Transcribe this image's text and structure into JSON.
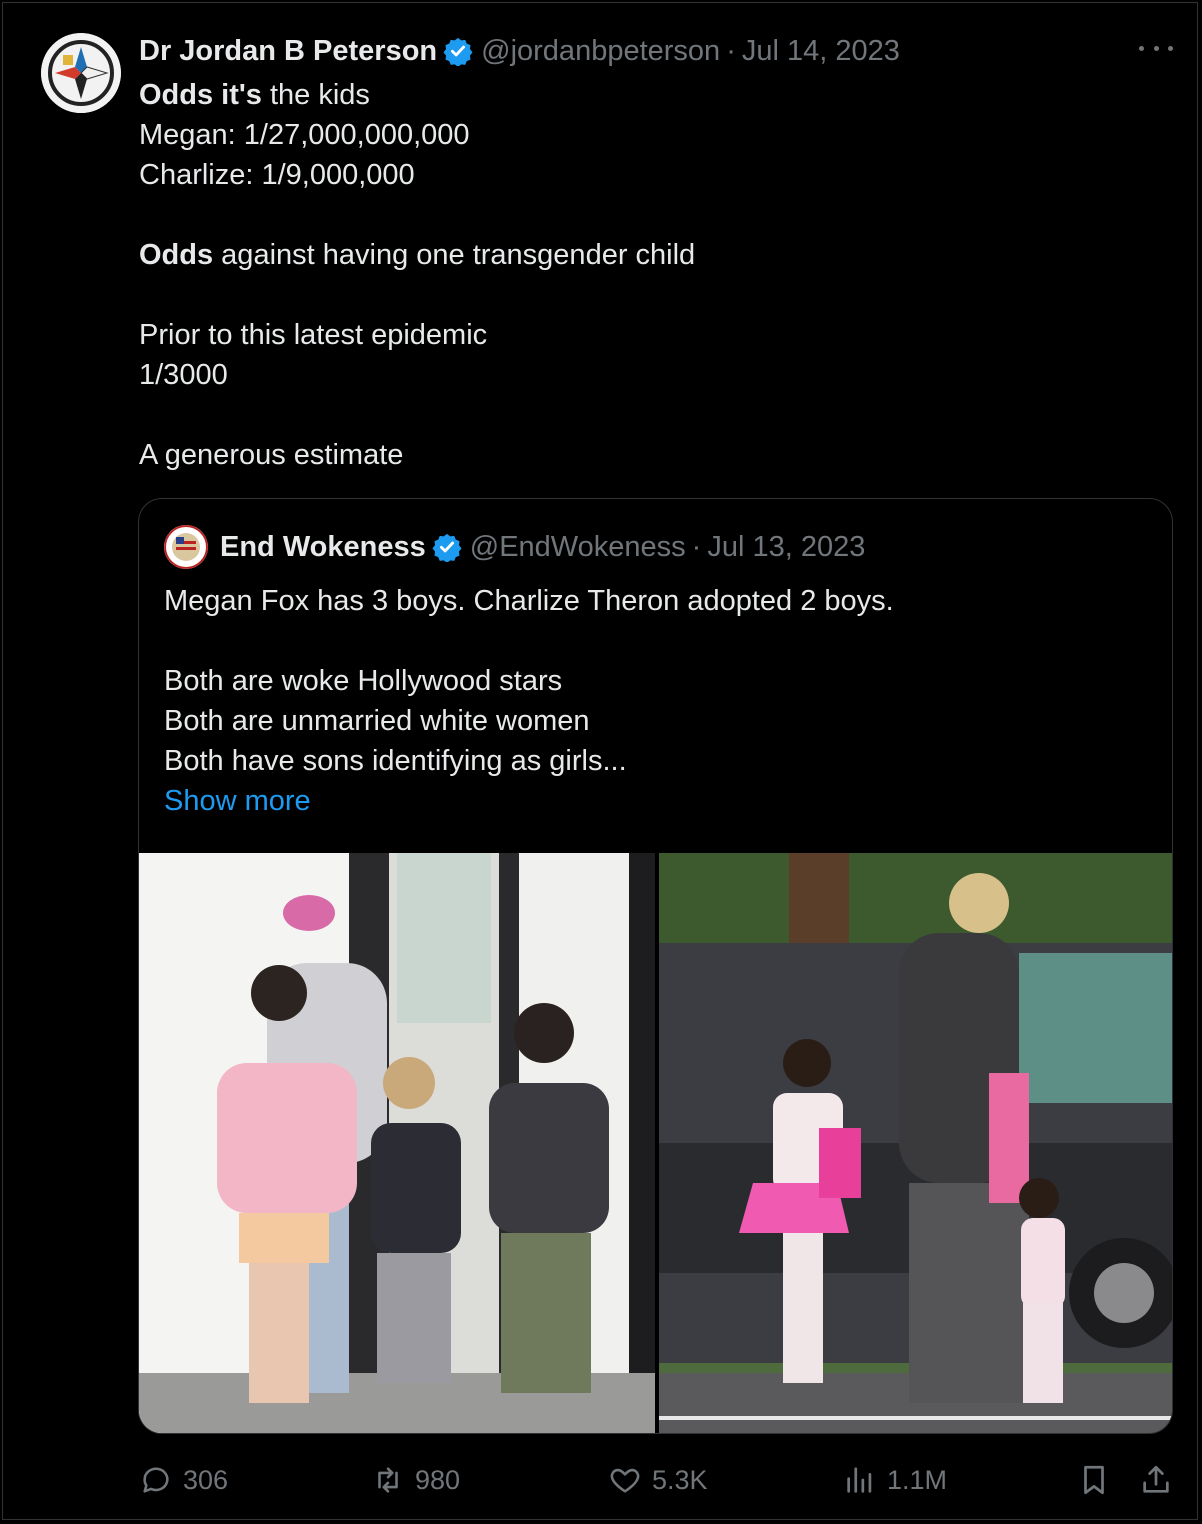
{
  "tweet": {
    "author_name": "Dr Jordan B Peterson",
    "handle": "@jordanbpeterson",
    "separator": "·",
    "date": "Jul 14, 2023",
    "lines": [
      {
        "bold": "Odds it's",
        "rest": " the kids"
      },
      {
        "bold": "",
        "rest": "Megan: 1/27,000,000,000"
      },
      {
        "bold": "",
        "rest": "Charlize: 1/9,000,000"
      },
      {
        "bold": "",
        "rest": ""
      },
      {
        "bold": "Odds",
        "rest": " against having one transgender child"
      },
      {
        "bold": "",
        "rest": ""
      },
      {
        "bold": "",
        "rest": "Prior to this latest epidemic"
      },
      {
        "bold": "",
        "rest": "1/3000"
      },
      {
        "bold": "",
        "rest": ""
      },
      {
        "bold": "",
        "rest": "A generous estimate"
      }
    ]
  },
  "quoted": {
    "author_name": "End Wokeness",
    "handle": "@EndWokeness",
    "separator": "·",
    "date": "Jul 13, 2023",
    "lines": [
      "Megan Fox has 3 boys. Charlize Theron adopted 2 boys.",
      "",
      "Both are woke Hollywood stars",
      "Both are unmarried white women",
      "Both have sons identifying as girls..."
    ],
    "show_more": "Show more"
  },
  "actions": {
    "replies": "306",
    "reposts": "980",
    "likes": "5.3K",
    "views": "1.1M"
  },
  "icons": [
    "verified-badge-icon",
    "more-icon",
    "reply-icon",
    "repost-icon",
    "like-icon",
    "views-icon",
    "bookmark-icon",
    "share-icon"
  ],
  "colors": {
    "accent": "#1d9bf0",
    "muted": "#71767b",
    "text": "#e7e9ea",
    "background": "#000000"
  }
}
